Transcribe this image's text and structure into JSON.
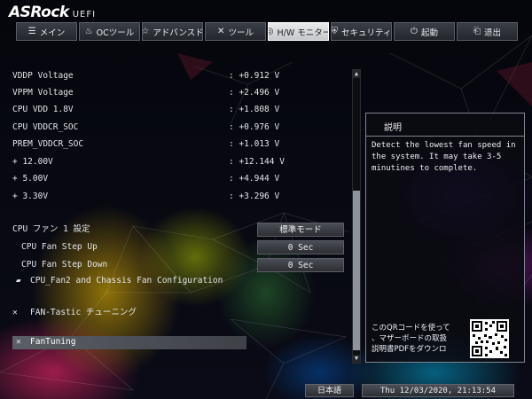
{
  "header": {
    "brand": "ASRock",
    "sub": "UEFI"
  },
  "tabs": [
    {
      "label": "メイン",
      "icon": "list-icon"
    },
    {
      "label": "OCツール",
      "icon": "flame-icon"
    },
    {
      "label": "アドバンスド",
      "icon": "star-icon"
    },
    {
      "label": "ツール",
      "icon": "tools-icon"
    },
    {
      "label": "H/W モニター",
      "icon": "monitor-icon",
      "active": true
    },
    {
      "label": "セキュリティ",
      "icon": "shield-icon"
    },
    {
      "label": "起動",
      "icon": "power-icon"
    },
    {
      "label": "退出",
      "icon": "exit-icon"
    }
  ],
  "voltages": [
    {
      "label": "VDDP Voltage",
      "value": ": +0.912 V"
    },
    {
      "label": "VPPM Voltage",
      "value": ": +2.496 V"
    },
    {
      "label": "CPU VDD 1.8V",
      "value": ": +1.808 V"
    },
    {
      "label": "CPU VDDCR_SOC",
      "value": ": +0.976 V"
    },
    {
      "label": "PREM_VDDCR_SOC",
      "value": ": +1.013 V"
    },
    {
      "label": "+ 12.00V",
      "value": ": +12.144 V"
    },
    {
      "label": "+ 5.00V",
      "value": ": +4.944 V"
    },
    {
      "label": "+ 3.30V",
      "value": ": +3.296 V"
    }
  ],
  "fan": {
    "setting_label": "CPU ファン 1 設定",
    "setting_value": "標準モード",
    "step_up_label": "CPU Fan Step Up",
    "step_up_value": "0 Sec",
    "step_down_label": "CPU Fan Step Down",
    "step_down_value": "0 Sec",
    "chassis_label": "CPU_Fan2 and Chassis Fan Configuration",
    "fan_tastic_label": "FAN-Tastic チューニング",
    "fan_tuning_label": "FanTuning"
  },
  "help": {
    "title": "説明",
    "text": "Detect the lowest fan speed in the system. It may take 3-5 minutines to complete.",
    "qr_text": "このQRコードを使って\n、マザーボードの取扱\n説明書PDFをダウンロ"
  },
  "footer": {
    "language": "日本語",
    "datetime": "Thu 12/03/2020, 21:13:54"
  },
  "colors": {
    "accent": "#8f939b",
    "active_tab": "#e0e1e4"
  }
}
